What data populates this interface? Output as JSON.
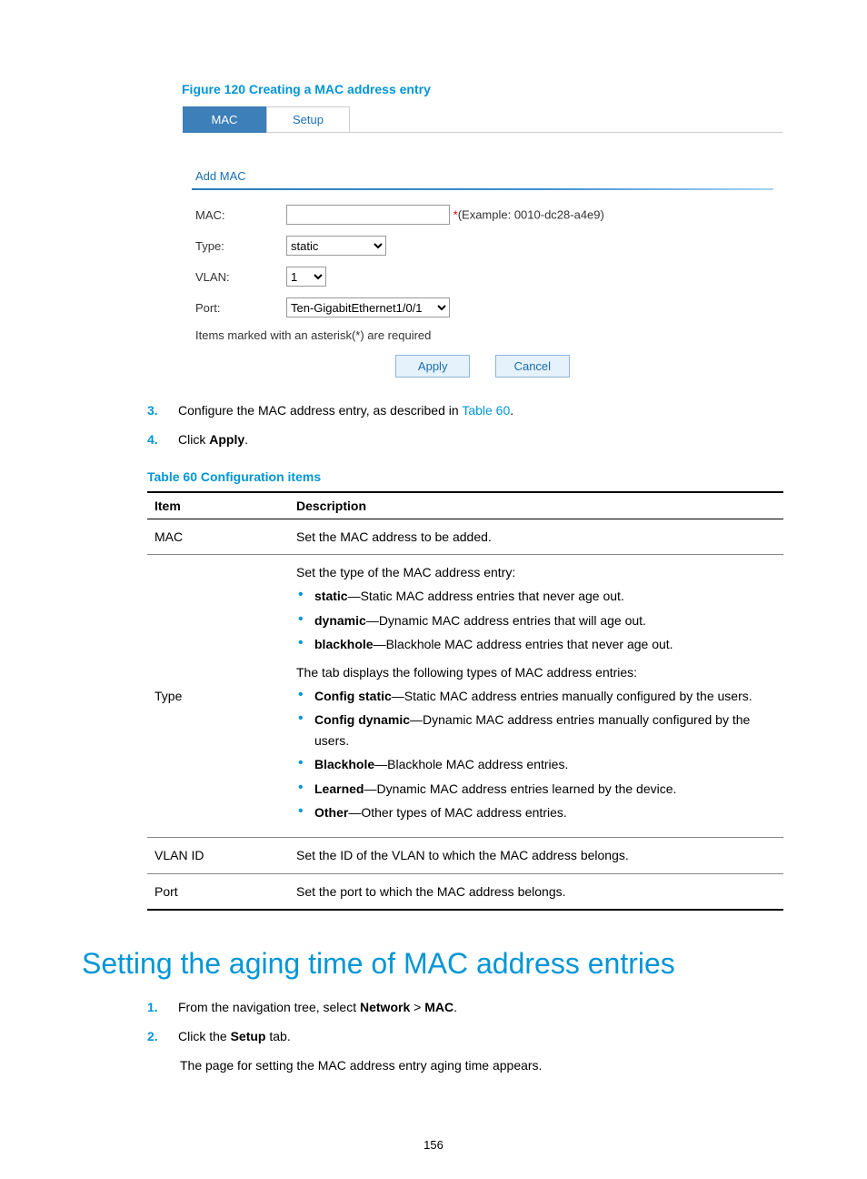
{
  "figure_caption": "Figure 120 Creating a MAC address entry",
  "ui": {
    "tabs": {
      "active": "MAC",
      "other": "Setup"
    },
    "section_title": "Add MAC",
    "fields": {
      "mac_label": "MAC:",
      "mac_value": "",
      "mac_hint": "(Example: 0010-dc28-a4e9)",
      "type_label": "Type:",
      "type_value": "static",
      "vlan_label": "VLAN:",
      "vlan_value": "1",
      "port_label": "Port:",
      "port_value": "Ten-GigabitEthernet1/0/1"
    },
    "required_note": "Items marked with an asterisk(*) are required",
    "apply": "Apply",
    "cancel": "Cancel"
  },
  "steps_a": {
    "s3_num": "3.",
    "s3_a": "Configure the MAC address entry, as described in ",
    "s3_link": "Table 60",
    "s3_b": ".",
    "s4_num": "4.",
    "s4_a": "Click ",
    "s4_b": "Apply",
    "s4_c": "."
  },
  "table_caption": "Table 60 Configuration items",
  "table": {
    "h1": "Item",
    "h2": "Description",
    "r1_item": "MAC",
    "r1_desc": "Set the MAC address to be added.",
    "r2_item": "Type",
    "r2_intro": "Set the type of the MAC address entry:",
    "r2_b1a": "static",
    "r2_b1b": "—Static MAC address entries that never age out.",
    "r2_b2a": "dynamic",
    "r2_b2b": "—Dynamic MAC address entries that will age out.",
    "r2_b3a": "blackhole",
    "r2_b3b": "—Blackhole MAC address entries that never age out.",
    "r2_mid": "The tab displays the following types of MAC address entries:",
    "r2_b4a": "Config static",
    "r2_b4b": "—Static MAC address entries manually configured by the users.",
    "r2_b5a": "Config dynamic",
    "r2_b5b": "—Dynamic MAC address entries manually configured by the users.",
    "r2_b6a": "Blackhole",
    "r2_b6b": "—Blackhole MAC address entries.",
    "r2_b7a": "Learned",
    "r2_b7b": "—Dynamic MAC address entries learned by the device.",
    "r2_b8a": "Other",
    "r2_b8b": "—Other types of MAC address entries.",
    "r3_item": "VLAN ID",
    "r3_desc": "Set the ID of the VLAN to which the MAC address belongs.",
    "r4_item": "Port",
    "r4_desc": "Set the port to which the MAC address belongs."
  },
  "heading": "Setting the aging time of MAC address entries",
  "steps_b": {
    "s1_num": "1.",
    "s1_a": "From the navigation tree, select ",
    "s1_b": "Network",
    "s1_c": " > ",
    "s1_d": "MAC",
    "s1_e": ".",
    "s2_num": "2.",
    "s2_a": "Click the ",
    "s2_b": "Setup",
    "s2_c": " tab.",
    "s2_sub": "The page for setting the MAC address entry aging time appears."
  },
  "page_number": "156"
}
